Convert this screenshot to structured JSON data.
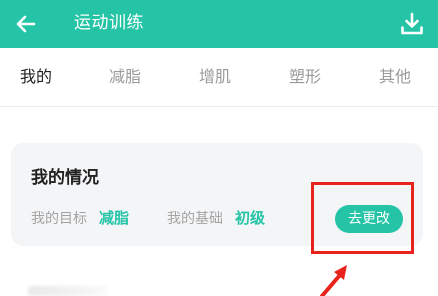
{
  "colors": {
    "accent": "#25c4a6",
    "annotation": "#e8231c"
  },
  "header": {
    "title": "运动训练",
    "back_icon": "arrow-left-icon",
    "download_icon": "download-icon"
  },
  "tabs": [
    {
      "label": "我的",
      "active": true
    },
    {
      "label": "减脂",
      "active": false
    },
    {
      "label": "增肌",
      "active": false
    },
    {
      "label": "塑形",
      "active": false
    },
    {
      "label": "其他",
      "active": false
    }
  ],
  "status_card": {
    "title": "我的情况",
    "goal_label": "我的目标",
    "goal_value": "减脂",
    "base_label": "我的基础",
    "base_value": "初级",
    "change_button": "去更改"
  }
}
